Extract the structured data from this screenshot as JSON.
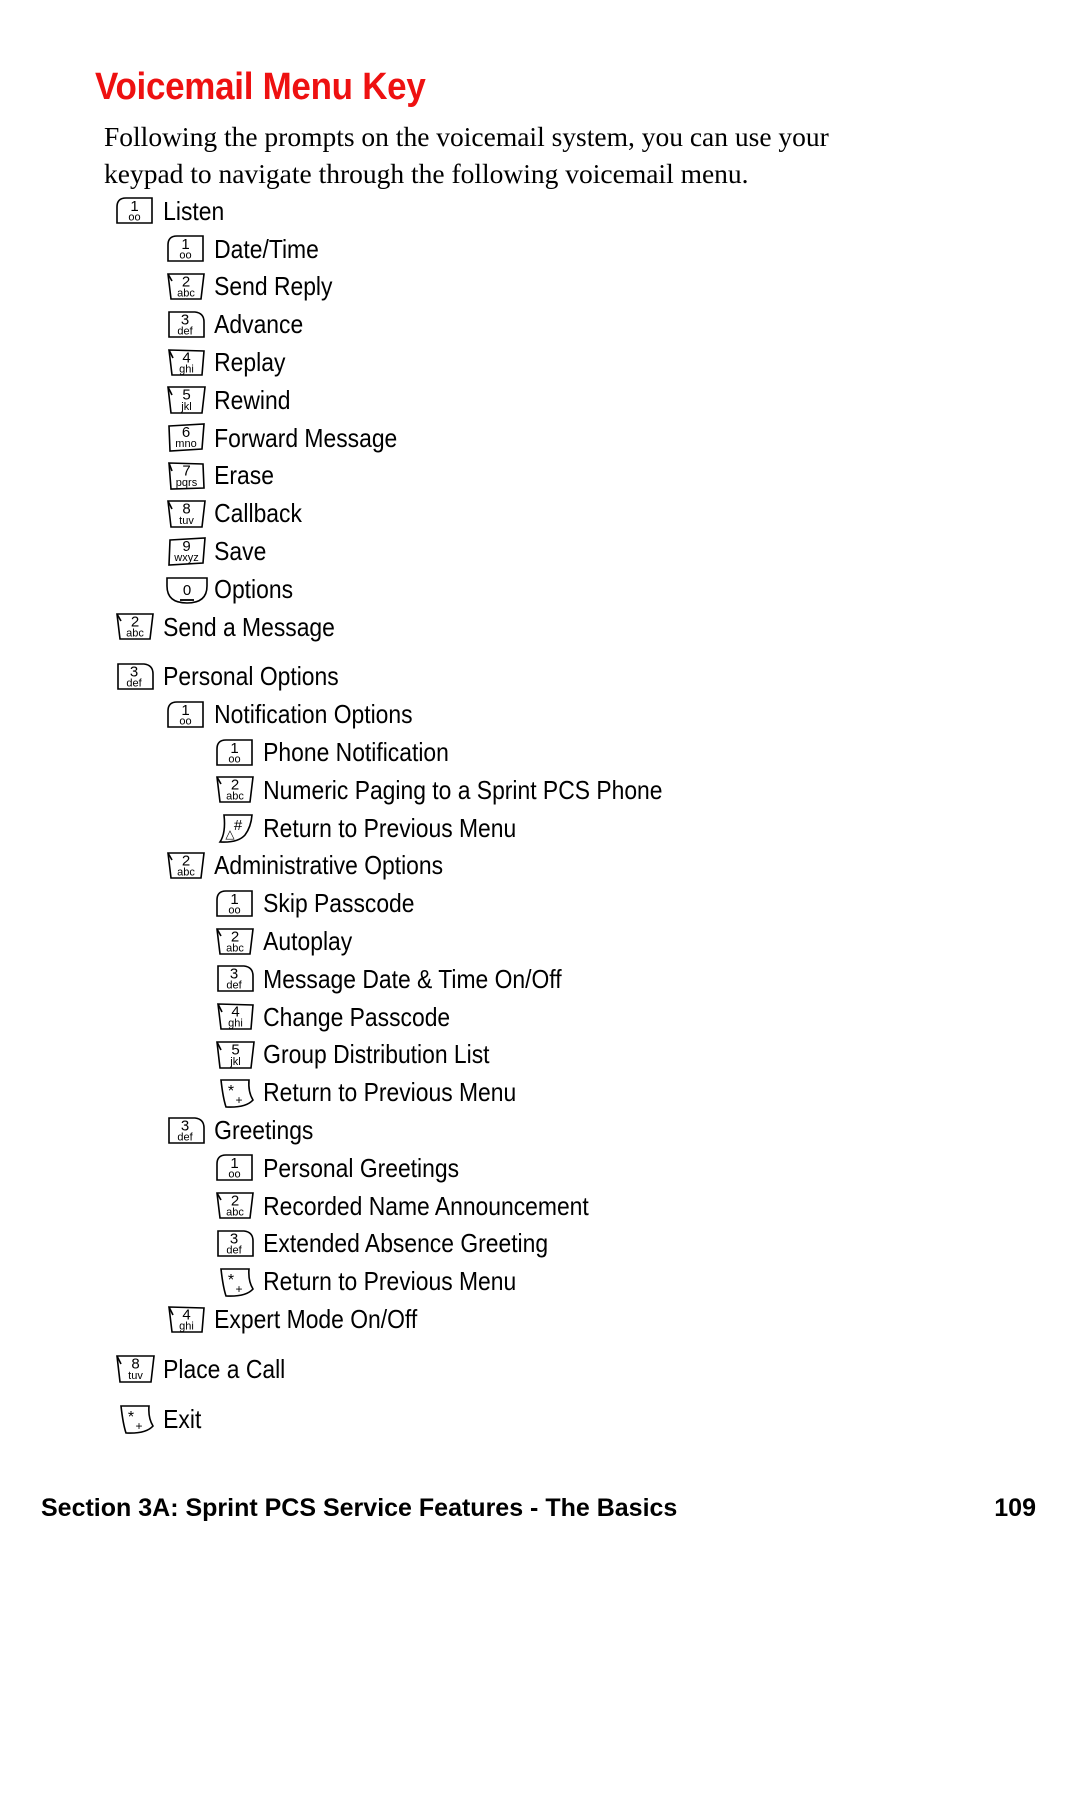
{
  "page": {
    "title": "Voicemail Menu Key",
    "title_color": "#ee1111",
    "intro": "Following the prompts on the voicemail system, you can use your keypad to navigate through the following voicemail menu.",
    "footer_section": "Section 3A: Sprint PCS Service Features - The Basics",
    "footer_page": "109"
  },
  "menu": [
    {
      "key": "1",
      "sub": "oo",
      "shape": "r1",
      "label": "Listen",
      "level": 0,
      "gap_before": false
    },
    {
      "key": "1",
      "sub": "oo",
      "shape": "r1",
      "label": "Date/Time",
      "level": 1,
      "gap_before": false
    },
    {
      "key": "2",
      "sub": "abc",
      "shape": "r2",
      "label": "Send Reply",
      "level": 1,
      "gap_before": false
    },
    {
      "key": "3",
      "sub": "def",
      "shape": "r3",
      "label": "Advance",
      "level": 1,
      "gap_before": false
    },
    {
      "key": "4",
      "sub": "ghi",
      "shape": "r4",
      "label": "Replay",
      "level": 1,
      "gap_before": false
    },
    {
      "key": "5",
      "sub": "jkl",
      "shape": "r5",
      "label": "Rewind",
      "level": 1,
      "gap_before": false
    },
    {
      "key": "6",
      "sub": "mno",
      "shape": "r6",
      "label": "Forward Message",
      "level": 1,
      "gap_before": false
    },
    {
      "key": "7",
      "sub": "pqrs",
      "shape": "r7",
      "label": "Erase",
      "level": 1,
      "gap_before": false
    },
    {
      "key": "8",
      "sub": "tuv",
      "shape": "r8",
      "label": "Callback",
      "level": 1,
      "gap_before": false
    },
    {
      "key": "9",
      "sub": "wxyz",
      "shape": "r9",
      "label": "Save",
      "level": 1,
      "gap_before": false
    },
    {
      "key": "0",
      "sub": "",
      "shape": "r0",
      "label": "Options",
      "level": 1,
      "gap_before": false
    },
    {
      "key": "2",
      "sub": "abc",
      "shape": "r2",
      "label": "Send a Message",
      "level": 0,
      "gap_before": false
    },
    {
      "key": "3",
      "sub": "def",
      "shape": "r3",
      "label": "Personal Options",
      "level": 0,
      "gap_before": true
    },
    {
      "key": "1",
      "sub": "oo",
      "shape": "r1",
      "label": "Notification Options",
      "level": 1,
      "gap_before": false
    },
    {
      "key": "1",
      "sub": "oo",
      "shape": "r1",
      "label": "Phone Notification",
      "level": 2,
      "gap_before": false
    },
    {
      "key": "2",
      "sub": "abc",
      "shape": "r2",
      "label": "Numeric Paging to a Sprint PCS Phone",
      "level": 2,
      "gap_before": false
    },
    {
      "key": "#",
      "sub": "",
      "shape": "rh",
      "label": "Return to Previous Menu",
      "level": 2,
      "gap_before": false
    },
    {
      "key": "2",
      "sub": "abc",
      "shape": "r2",
      "label": "Administrative Options",
      "level": 1,
      "gap_before": false
    },
    {
      "key": "1",
      "sub": "oo",
      "shape": "r1",
      "label": "Skip Passcode",
      "level": 2,
      "gap_before": false
    },
    {
      "key": "2",
      "sub": "abc",
      "shape": "r2",
      "label": "Autoplay",
      "level": 2,
      "gap_before": false
    },
    {
      "key": "3",
      "sub": "def",
      "shape": "r3",
      "label": "Message Date & Time On/Off",
      "level": 2,
      "gap_before": false
    },
    {
      "key": "4",
      "sub": "ghi",
      "shape": "r4",
      "label": "Change Passcode",
      "level": 2,
      "gap_before": false
    },
    {
      "key": "5",
      "sub": "jkl",
      "shape": "r5",
      "label": "Group Distribution List",
      "level": 2,
      "gap_before": false
    },
    {
      "key": "*",
      "sub": "",
      "shape": "rs",
      "label": "Return to Previous Menu",
      "level": 2,
      "gap_before": false
    },
    {
      "key": "3",
      "sub": "def",
      "shape": "r3",
      "label": "Greetings",
      "level": 1,
      "gap_before": false
    },
    {
      "key": "1",
      "sub": "oo",
      "shape": "r1",
      "label": "Personal Greetings",
      "level": 2,
      "gap_before": false
    },
    {
      "key": "2",
      "sub": "abc",
      "shape": "r2",
      "label": "Recorded Name Announcement",
      "level": 2,
      "gap_before": false
    },
    {
      "key": "3",
      "sub": "def",
      "shape": "r3",
      "label": "Extended Absence Greeting",
      "level": 2,
      "gap_before": false
    },
    {
      "key": "*",
      "sub": "",
      "shape": "rs",
      "label": "Return to Previous Menu",
      "level": 2,
      "gap_before": false
    },
    {
      "key": "4",
      "sub": "ghi",
      "shape": "r4",
      "label": "Expert Mode On/Off",
      "level": 1,
      "gap_before": false
    },
    {
      "key": "8",
      "sub": "tuv",
      "shape": "r8",
      "label": "Place a Call",
      "level": 0,
      "gap_before": true
    },
    {
      "key": "*",
      "sub": "",
      "shape": "rs",
      "label": "Exit",
      "level": 0,
      "gap_before": true
    }
  ]
}
